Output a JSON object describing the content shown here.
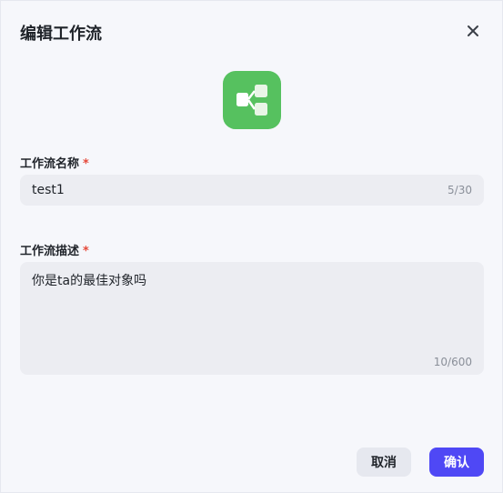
{
  "dialog": {
    "title": "编辑工作流",
    "close_icon": "close-icon",
    "app_icon": "workflow-icon",
    "app_icon_color": "#56c15f"
  },
  "form": {
    "name": {
      "label": "工作流名称",
      "required_mark": "*",
      "value": "test1",
      "count": "5/30"
    },
    "description": {
      "label": "工作流描述",
      "required_mark": "*",
      "value": "你是ta的最佳对象吗",
      "count": "10/600"
    }
  },
  "footer": {
    "cancel_label": "取消",
    "confirm_label": "确认",
    "confirm_color": "#4f48f5"
  }
}
